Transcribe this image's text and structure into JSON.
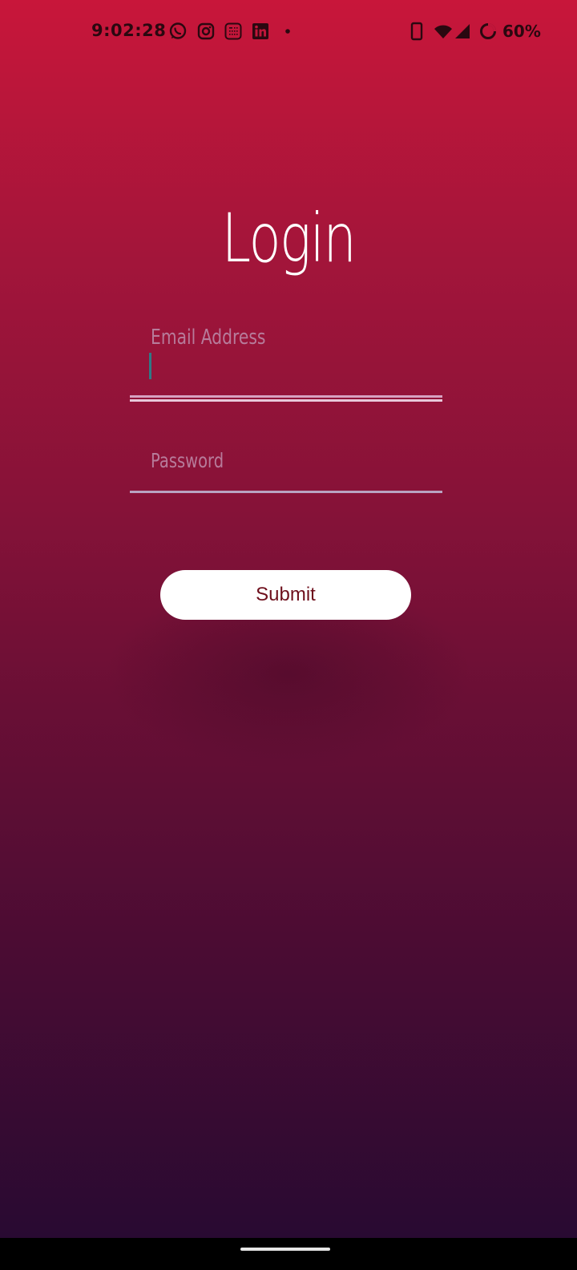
{
  "status_bar": {
    "time": "9:02:28",
    "battery_percent": "60%",
    "notification_icons": [
      "whatsapp-icon",
      "instagram-icon",
      "calculator-icon",
      "linkedin-icon",
      "dot-icon"
    ],
    "system_icons": [
      "phone-icon",
      "wifi-icon",
      "cell-signal-icon",
      "battery-ring-icon"
    ]
  },
  "login": {
    "title": "Login",
    "email_placeholder": "Email Address",
    "email_value": "",
    "password_placeholder": "Password",
    "password_value": "",
    "submit_label": "Submit"
  },
  "colors": {
    "gradient_top": "#c8163a",
    "gradient_bottom": "#250a32",
    "button_text": "#6e0f1c",
    "placeholder": "#b77b9a"
  }
}
